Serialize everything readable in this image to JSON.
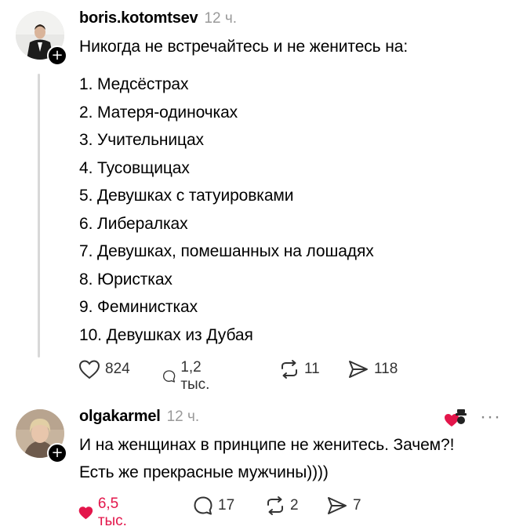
{
  "post1": {
    "username": "boris.kotomtsev",
    "time": "12 ч.",
    "intro": "Никогда не встречайтесь и не женитесь на:",
    "items": [
      "1. Медсёстрах",
      "2. Матеря-одиночках",
      "3. Учительницах",
      "4. Тусовщицах",
      "5. Девушках с татуировками",
      "6. Либералках",
      "7. Девушках, помешанных на лошадях",
      "8. Юристках",
      "9. Феминистках",
      "10. Девушках из Дубая"
    ],
    "likes": "824",
    "replies": "1,2 тыс.",
    "reposts": "11",
    "shares": "118"
  },
  "post2": {
    "username": "olgakarmel",
    "time": "12 ч.",
    "lines": [
      "И на женщинах в принципе не женитесь. Зачем?!",
      "Есть же прекрасные мужчины))))"
    ],
    "likes": "6,5 тыс.",
    "replies": "17",
    "reposts": "2",
    "shares": "7",
    "more": "···"
  },
  "icons": {
    "plus": "+",
    "heart": "heart-icon",
    "comment": "comment-icon",
    "repost": "repost-icon",
    "share": "share-icon"
  },
  "colors": {
    "like_active": "#e3164b",
    "muted": "#9a9a9a"
  }
}
